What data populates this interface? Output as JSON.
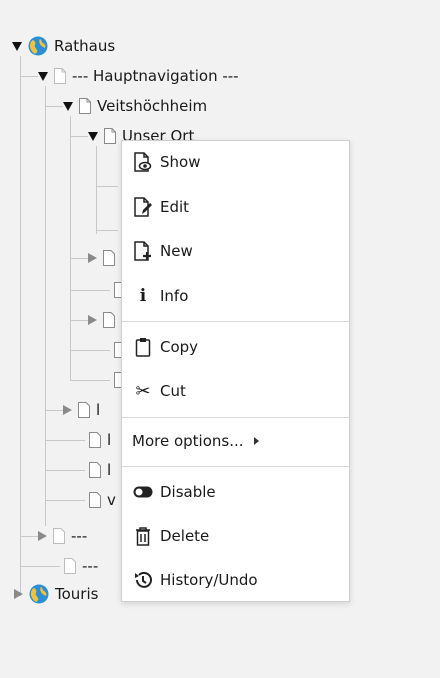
{
  "tree": {
    "root1": {
      "label": "Rathaus"
    },
    "hauptnav": {
      "label": "--- Hauptnavigation ---"
    },
    "veits": {
      "label": "Veitshöchheim"
    },
    "unserort": {
      "label": "Unser Ort"
    },
    "root2": {
      "label": "Touris"
    },
    "hidden_a": {
      "label": "l"
    },
    "hidden_b": {
      "label": "l"
    },
    "hidden_c": {
      "label": "l"
    },
    "hidden_d": {
      "label": "v"
    },
    "hidden_e": {
      "label": "---"
    },
    "hidden_f": {
      "label": "---"
    }
  },
  "context_menu": {
    "items": [
      {
        "label": "Show",
        "icon": "show-icon"
      },
      {
        "label": "Edit",
        "icon": "edit-icon"
      },
      {
        "label": "New",
        "icon": "new-page-icon"
      },
      {
        "label": "Info",
        "icon": "info-icon"
      },
      {
        "label": "Copy",
        "icon": "clipboard-icon"
      },
      {
        "label": "Cut",
        "icon": "scissors-icon"
      },
      {
        "label": "More options...",
        "icon": "submenu-arrow-icon"
      },
      {
        "label": "Disable",
        "icon": "toggle-icon"
      },
      {
        "label": "Delete",
        "icon": "trash-icon"
      },
      {
        "label": "History/Undo",
        "icon": "history-icon"
      }
    ]
  }
}
